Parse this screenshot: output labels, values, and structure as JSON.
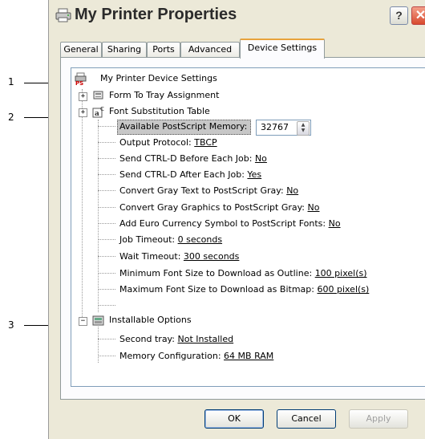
{
  "window": {
    "title": "My Printer Properties",
    "help_label": "?",
    "close_label": "✕"
  },
  "tabs": [
    {
      "label": "General"
    },
    {
      "label": "Sharing"
    },
    {
      "label": "Ports"
    },
    {
      "label": "Advanced"
    },
    {
      "label": "Device Settings",
      "active": true
    }
  ],
  "tree": {
    "root": "My Printer Device Settings",
    "form_to_tray": "Form To Tray Assignment",
    "font_substitution": "Font Substitution Table",
    "available_memory_label": "Available PostScript Memory:",
    "available_memory_value": "32767",
    "output_protocol": {
      "label": "Output Protocol:",
      "value": "TBCP"
    },
    "ctrl_d_before": {
      "label": "Send CTRL-D Before Each Job:",
      "value": "No"
    },
    "ctrl_d_after": {
      "label": "Send CTRL-D After Each Job:",
      "value": "Yes"
    },
    "gray_text": {
      "label": "Convert Gray Text to PostScript Gray:",
      "value": "No"
    },
    "gray_graphics": {
      "label": "Convert Gray Graphics to PostScript Gray:",
      "value": "No"
    },
    "euro": {
      "label": "Add Euro Currency Symbol to PostScript Fonts:",
      "value": "No"
    },
    "job_timeout": {
      "label": "Job Timeout:",
      "value": "0 seconds"
    },
    "wait_timeout": {
      "label": "Wait Timeout:",
      "value": "300 seconds"
    },
    "min_font": {
      "label": "Minimum Font Size to Download as Outline:",
      "value": "100 pixel(s)"
    },
    "max_font": {
      "label": "Maximum Font Size to Download as Bitmap:",
      "value": "600 pixel(s)"
    },
    "installable_options": "Installable Options",
    "second_tray": {
      "label": "Second tray:",
      "value": "Not Installed"
    },
    "memory_config": {
      "label": "Memory Configuration:",
      "value": "64 MB RAM"
    }
  },
  "buttons": {
    "ok": "OK",
    "cancel": "Cancel",
    "apply": "Apply"
  },
  "callouts": {
    "one": "1",
    "two": "2",
    "three": "3"
  }
}
